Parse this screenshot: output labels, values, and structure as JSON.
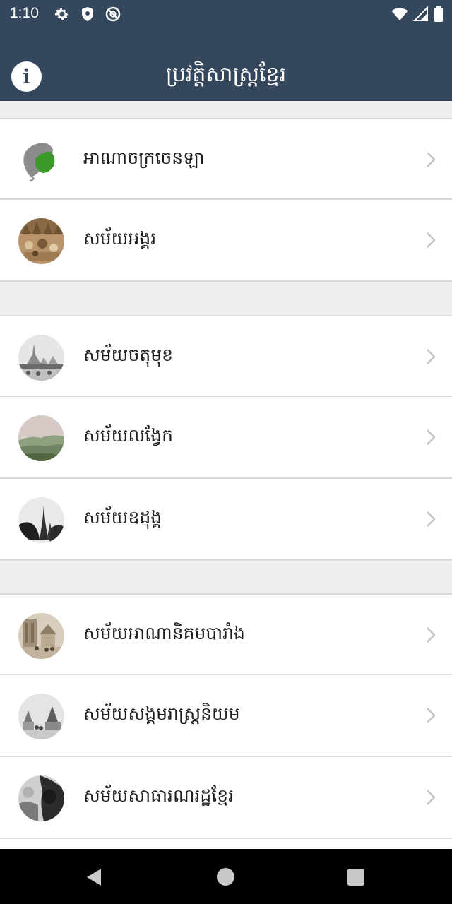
{
  "status_bar": {
    "time": "1:10",
    "left_icons": [
      "settings-icon",
      "shield-icon",
      "at-sign-icon"
    ],
    "right_icons": [
      "wifi-icon",
      "signal-icon",
      "battery-icon"
    ]
  },
  "app_bar": {
    "title": "ប្រវត្តិសាស្ត្រខ្មែរ",
    "info_label": "i"
  },
  "list": {
    "items": [
      {
        "label": "អាណាចក្រចេនឡា",
        "thumb": "map-thumbnail"
      },
      {
        "label": "សម័យអង្គរ",
        "thumb": "angkor-mural-thumbnail"
      },
      {
        "label": "សម័យចតុមុខ",
        "thumb": "chaktomuk-temple-thumbnail"
      },
      {
        "label": "សម័យលង្វែក",
        "thumb": "longvek-landscape-thumbnail"
      },
      {
        "label": "សម័យឧដុង្គ",
        "thumb": "oudong-stupa-thumbnail"
      },
      {
        "label": "សម័យអាណានិគមបារាំង",
        "thumb": "colonial-photo-thumbnail"
      },
      {
        "label": "សម័យសង្គមរាស្ត្រនិយម",
        "thumb": "sangkum-photo-thumbnail"
      },
      {
        "label": "សម័យសាធារណរដ្ឋខ្មែរ",
        "thumb": "republic-photo-thumbnail"
      }
    ]
  },
  "nav_bar": {
    "buttons": [
      "back-icon",
      "home-icon",
      "recents-icon"
    ]
  },
  "colors": {
    "app_bar": "#34475c",
    "background": "#efefef",
    "divider": "#d9d9d9",
    "map_green": "#3a9a2a"
  }
}
